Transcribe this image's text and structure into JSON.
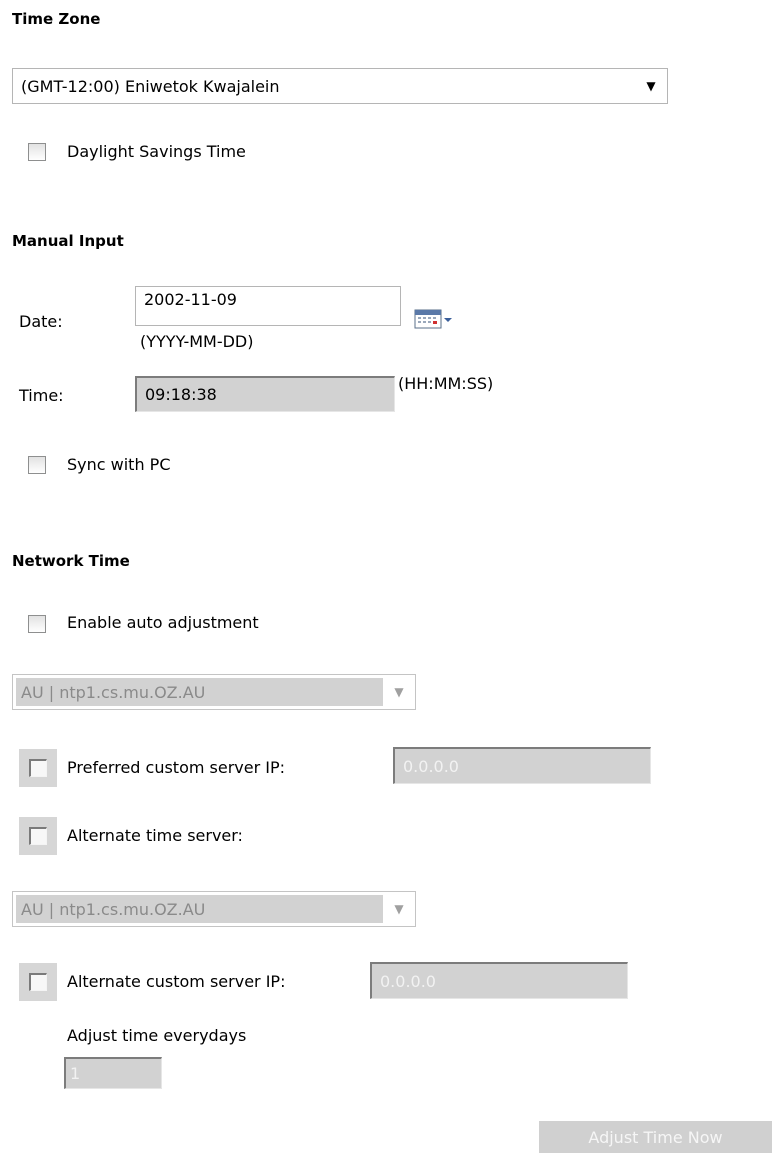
{
  "time_zone": {
    "heading": "Time Zone",
    "selected": "(GMT-12:00) Eniwetok Kwajalein",
    "dropdown_icon": "caret-down-icon",
    "daylight_savings_label": "Daylight Savings Time",
    "daylight_savings_checked": false
  },
  "manual_input": {
    "heading": "Manual Input",
    "date_label": "Date:",
    "date_value": "2002-11-09",
    "date_format": "(YYYY-MM-DD)",
    "calendar_icon": "calendar-icon",
    "time_label": "Time:",
    "time_value": "09:18:38",
    "time_format": "(HH:MM:SS)",
    "sync_label": "Sync with PC",
    "sync_checked": false
  },
  "network_time": {
    "heading": "Network Time",
    "enable_label": "Enable auto adjustment",
    "enable_checked": false,
    "server_select": "AU | ntp1.cs.mu.OZ.AU",
    "preferred_ip_label": "Preferred custom server IP:",
    "preferred_ip_value": "0.0.0.0",
    "alternate_label": "Alternate time server:",
    "alternate_select": "AU | ntp1.cs.mu.OZ.AU",
    "alternate_ip_label": "Alternate custom server IP:",
    "alternate_ip_value": "0.0.0.0",
    "adjust_days_label": "Adjust time everydays",
    "adjust_days_value": "1",
    "adjust_button": "Adjust Time Now"
  }
}
